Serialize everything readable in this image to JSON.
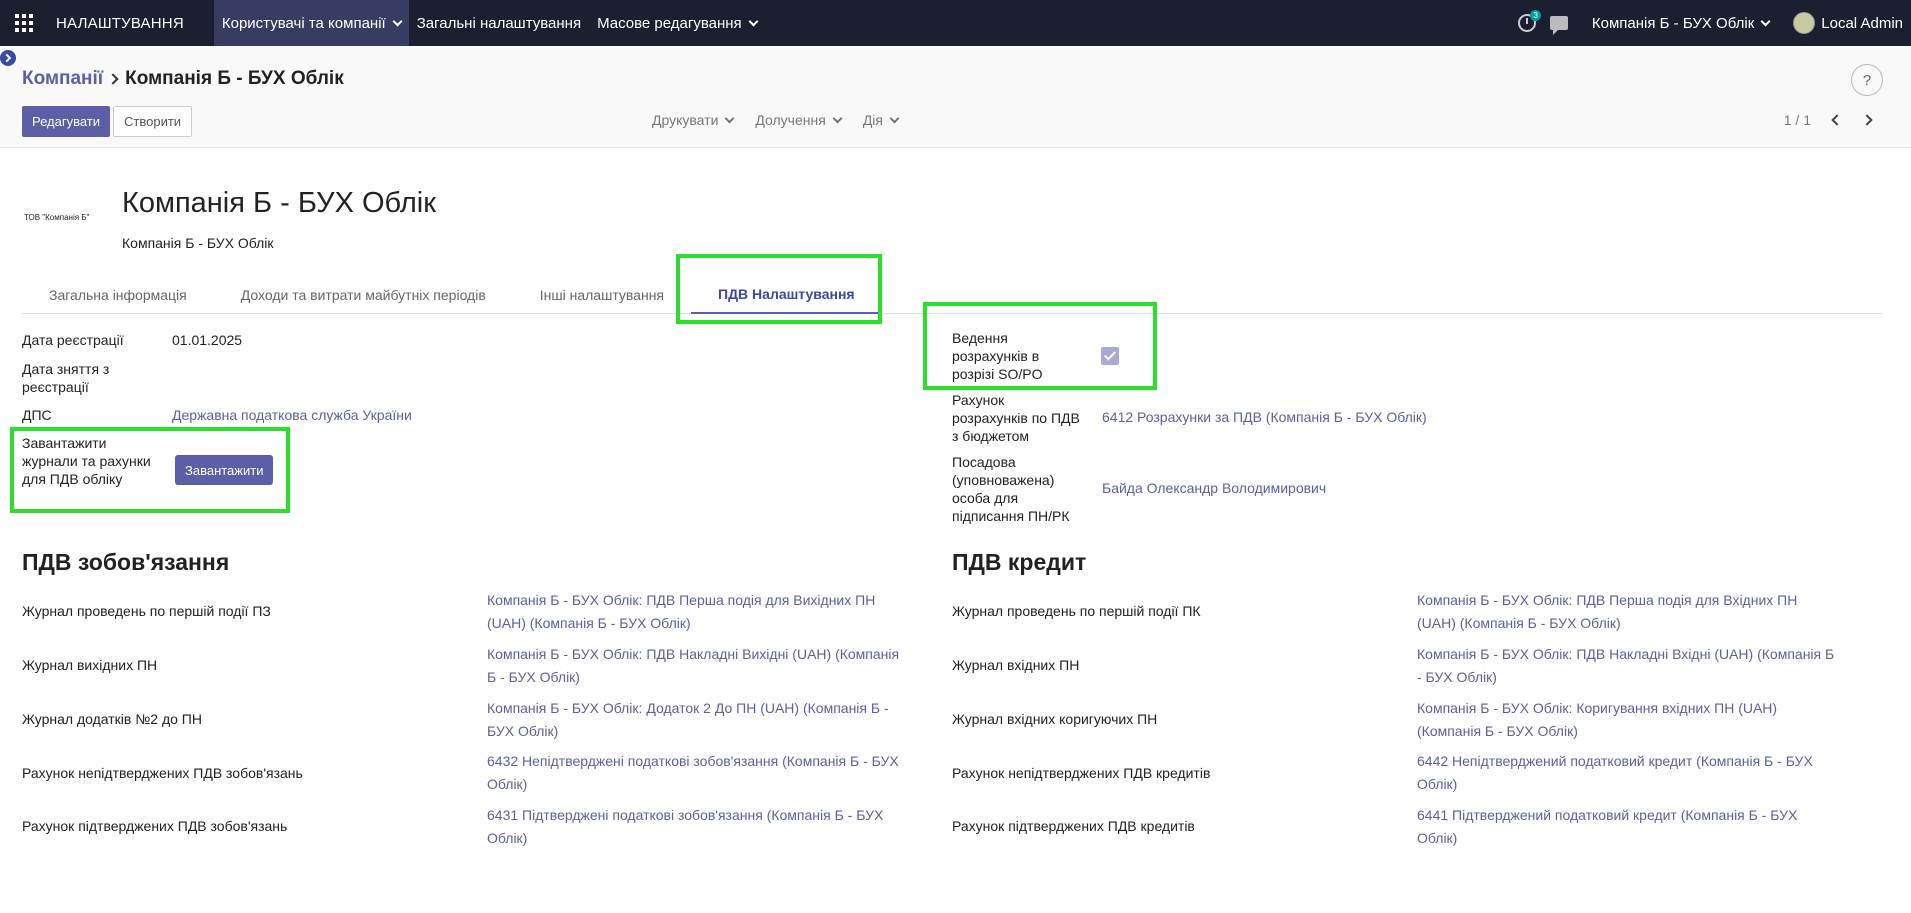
{
  "navbar": {
    "brand": "НАЛАШТУВАННЯ",
    "menu": [
      {
        "label": "Користувачі та компанії",
        "dropdown": true,
        "active": true
      },
      {
        "label": "Загальні налаштування",
        "dropdown": false,
        "active": false
      },
      {
        "label": "Масове редагування",
        "dropdown": true,
        "active": false
      }
    ],
    "activity_badge": "3",
    "company": "Компанія Б - БУХ Облік",
    "user": "Local Admin"
  },
  "control_panel": {
    "breadcrumb_parent": "Компанії",
    "breadcrumb_current": "Компанія Б - БУХ Облік",
    "edit_label": "Редагувати",
    "create_label": "Створити",
    "print_label": "Друкувати",
    "attachments_label": "Долучення",
    "action_label": "Дія",
    "pager": "1 / 1",
    "help": "?"
  },
  "company": {
    "logo_text": "ТОВ \"Компанія Б\"",
    "name": "Компанія Б - БУХ Облік",
    "subtitle": "Компанія Б - БУХ Облік"
  },
  "tabs": [
    {
      "label": "Загальна інформація"
    },
    {
      "label": "Доходи та витрати майбутніх періодів"
    },
    {
      "label": "Інші налаштування"
    },
    {
      "label": "ПДВ Налаштування"
    }
  ],
  "left_fields": {
    "reg_date_label": "Дата реєстрації",
    "reg_date_value": "01.01.2025",
    "dereg_label": "Дата зняття з реєстрації",
    "dps_label": "ДПС",
    "dps_value": "Державна податкова служба України",
    "load_label": "Завантажити журнали та рахунки для ПДВ обліку",
    "load_button": "Завантажити"
  },
  "right_fields": {
    "so_po_label": "Ведення розрахунків в розрізі SO/PO",
    "so_po_checked": true,
    "budget_label": "Рахунок розрахунків по ПДВ з бюджетом",
    "budget_value": "6412 Розрахунки за ПДВ (Компанія Б - БУХ Облік)",
    "signer_label": "Посадова (уповноважена) особа для підписання ПН/РК",
    "signer_value": "Байда Олександр Володимирович"
  },
  "vat_liability": {
    "title": "ПДВ зобов'язання",
    "rows": [
      {
        "label": "Журнал проведень по першій події ПЗ",
        "value": "Компанія Б - БУХ Облік: ПДВ Перша подія для Вихідних ПН (UAH) (Компанія Б - БУХ Облік)"
      },
      {
        "label": "Журнал вихідних ПН",
        "value": "Компанія Б - БУХ Облік: ПДВ Накладні Вихідні (UAH) (Компанія Б - БУХ Облік)"
      },
      {
        "label": "Журнал додатків №2 до ПН",
        "value": "Компанія Б - БУХ Облік: Додаток 2 До ПН (UAH) (Компанія Б - БУХ Облік)"
      },
      {
        "label": "Рахунок непідтверджених ПДВ зобов'язань",
        "value": "6432 Непідтверджені податкові зобов'язання (Компанія Б - БУХ Облік)"
      },
      {
        "label": "Рахунок підтверджених ПДВ зобов'язань",
        "value": "6431 Підтверджені податкові зобов'язання (Компанія Б - БУХ Облік)"
      }
    ]
  },
  "vat_credit": {
    "title": "ПДВ кредит",
    "rows": [
      {
        "label": "Журнал проведень по першій події ПК",
        "value": "Компанія Б - БУХ Облік: ПДВ Перша подія для Вхідних ПН (UAH) (Компанія Б - БУХ Облік)"
      },
      {
        "label": "Журнал вхідних ПН",
        "value": "Компанія Б - БУХ Облік: ПДВ Накладні Вхідні (UAH) (Компанія Б - БУХ Облік)"
      },
      {
        "label": "Журнал вхідних коригуючих ПН",
        "value": "Компанія Б - БУХ Облік: Коригування вхідних ПН (UAH) (Компанія Б - БУХ Облік)"
      },
      {
        "label": "Рахунок непідтверджених ПДВ кредитів",
        "value": "6442 Непідтверджений податковий кредит (Компанія Б - БУХ Облік)"
      },
      {
        "label": "Рахунок підтверджених ПДВ кредитів",
        "value": "6441 Підтверджений податковий кредит (Компанія Б - БУХ Облік)"
      }
    ]
  },
  "colors": {
    "navbar_bg": "#1c1f2f",
    "primary": "#5a5fa8",
    "highlight": "#2bdf2b"
  }
}
